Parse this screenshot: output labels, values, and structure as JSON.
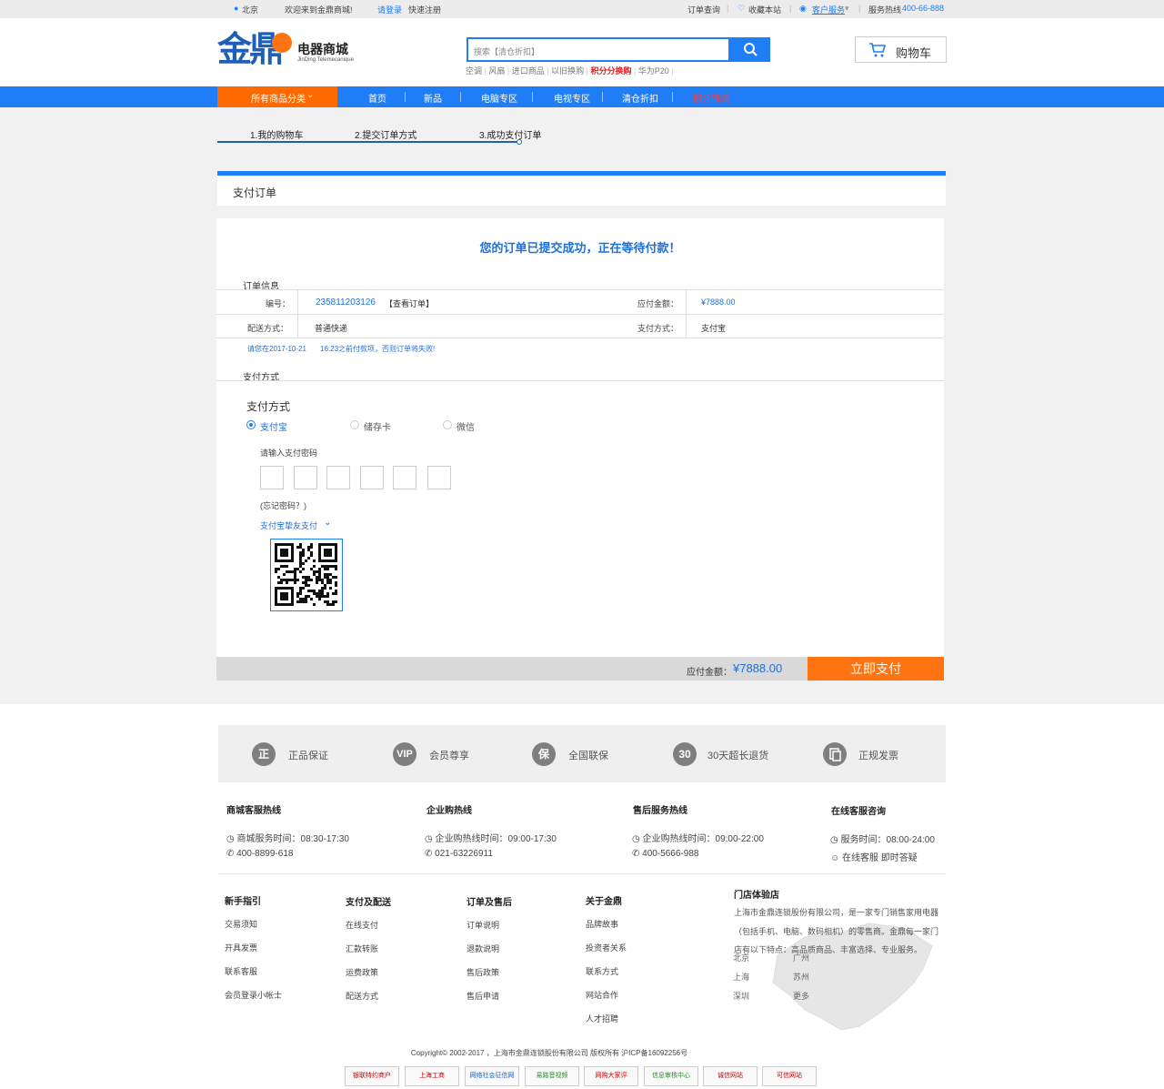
{
  "topbar": {
    "location": "北京",
    "welcome": "欢迎来到金鼎商城!",
    "login": "请登录",
    "register": "快速注册",
    "order_query": "订单查询",
    "favorite": "收藏本站",
    "customer_service": "客户服务",
    "hotline_label": "服务热线",
    "hotline_number": "400-66-888"
  },
  "header": {
    "logo_main": "金鼎",
    "logo_cn": "电器商城",
    "logo_en": "JinDing Telemecanique",
    "search_placeholder": "搜索【清仓折扣】",
    "hot_words": [
      "空调",
      "风扇",
      "进口商品",
      "以旧换购",
      "积分分换购",
      "华为P20"
    ],
    "cart_label": "购物车"
  },
  "nav": {
    "all_categories": "所有商品分类",
    "items": [
      "首页",
      "新品",
      "电脑专区",
      "电视专区",
      "清仓折扣",
      "积分商城"
    ]
  },
  "steps": [
    "1.我的购物车",
    "2.提交订单方式",
    "3.成功支付订单"
  ],
  "panel_title": "支付订单",
  "success_message": "您的订单已提交成功，正在等待付款！",
  "order_info": {
    "section_title": "订单信息",
    "number_label": "编号：",
    "number_value": "235811203126",
    "view_order": "【查看订单】",
    "amount_label": "应付金额：",
    "amount_value": "¥7888.00",
    "delivery_label": "配送方式：",
    "delivery_value": "普通快递",
    "payment_label": "支付方式：",
    "payment_value": "支付宝",
    "deadline_prefix": "请您在2017-10-21",
    "deadline_suffix": "16:23之前付款项，否则订单将失败!"
  },
  "payment": {
    "section_title": "支付方式",
    "heading": "支付方式",
    "options": [
      "支付宝",
      "储存卡",
      "微信"
    ],
    "selected": "支付宝",
    "password_prompt": "请输入支付密码",
    "forgot_password": "(忘记密码？)",
    "friend_pay": "支付宝挚友支付"
  },
  "summary": {
    "amount_label": "应付金额：",
    "amount_value": "¥7888.00",
    "pay_button": "立即支付"
  },
  "features": [
    "正品保证",
    "会员尊享",
    "全国联保",
    "30天超长退货",
    "正规发票"
  ],
  "feature_icons": [
    "正",
    "VIP",
    "保",
    "30",
    ""
  ],
  "hotlines": [
    {
      "title": "商城客服热线",
      "line1": "商城服务时间：08:30-17:30",
      "line2": "400-8899-618"
    },
    {
      "title": "企业购热线",
      "line1": "企业购热线时间：09:00-17:30",
      "line2": "021-63226911"
    },
    {
      "title": "售后服务热线",
      "line1": "企业购热线时间：09:00-22:00",
      "line2": "400-5666-988"
    },
    {
      "title": "在线客服咨询",
      "line1": "服务时间：08:00-24:00",
      "line2": "在线客服 即时答疑"
    }
  ],
  "footer_links": [
    {
      "title": "新手指引",
      "items": [
        "交易须知",
        "开具发票",
        "联系客服",
        "会员登录小帐士"
      ]
    },
    {
      "title": "支付及配送",
      "items": [
        "在线支付",
        "汇款转账",
        "运费政策",
        "配送方式"
      ]
    },
    {
      "title": "订单及售后",
      "items": [
        "订单说明",
        "退款说明",
        "售后政策",
        "售后申请"
      ]
    },
    {
      "title": "关于金鼎",
      "items": [
        "品牌故事",
        "投资者关系",
        "联系方式",
        "网站合作",
        "人才招聘"
      ]
    }
  ],
  "stores": {
    "title": "门店体验店",
    "description": "上海市金鼎连锁股份有限公司，是一家专门销售家用电器（包括手机、电脑、数码相机）的零售商。金鼎每一家门店有以下特点：高品质商品、丰富选择、专业服务。",
    "cities": [
      "北京",
      "广州",
      "上海",
      "苏州",
      "深圳",
      "更多"
    ]
  },
  "copyright": "Copyright© 2002-2017 ，上海市金鼎连锁股份有限公司 版权所有 沪ICP备16092256号",
  "badges": [
    "银联特约商户",
    "上海工商",
    "网络社会征信网",
    "易路音视频",
    "网购大家评",
    "信息审核中心",
    "诚信网站",
    "可信网站"
  ],
  "colors": {
    "primary": "#1f7ef5",
    "accent": "#ff7311",
    "nav_accent": "#ff6a00"
  }
}
